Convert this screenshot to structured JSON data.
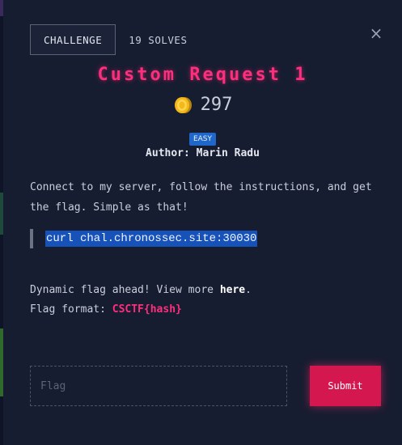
{
  "tabs": {
    "challenge_label": "CHALLENGE",
    "solves_label": "19 SOLVES"
  },
  "close_icon": "close-icon",
  "challenge": {
    "title": "Custom Request 1",
    "points": "297",
    "points_icon": "coin-icon",
    "difficulty": "EASY",
    "author_line": "Author: Marin Radu",
    "description": "Connect to my server, follow the instructions, and get the flag. Simple as that!",
    "command": "curl chal.chronossec.site:30030",
    "dynamic_text": "Dynamic flag ahead! View more ",
    "dynamic_link": "here",
    "dynamic_suffix": ".",
    "flag_format_label": "Flag format: ",
    "flag_format": "CSCTF{hash}"
  },
  "form": {
    "flag_placeholder": "Flag",
    "flag_value": "",
    "submit_label": "Submit"
  },
  "colors": {
    "accent_pink": "#ff2e7c",
    "submit_bg": "#d4174f",
    "badge_blue": "#1f67c9",
    "modal_bg": "#171d31",
    "selection_blue": "#1652b8"
  }
}
